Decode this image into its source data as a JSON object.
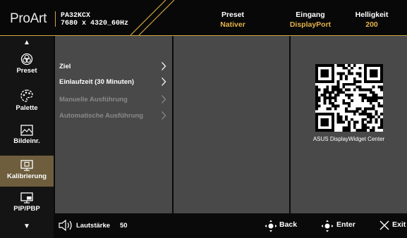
{
  "header": {
    "brand": "ProArt",
    "model": "PA32KCX",
    "resolution": "7680 x 4320_60Hz",
    "preset_label": "Preset",
    "preset_value": "Nativer",
    "input_label": "Eingang",
    "input_value": "DisplayPort",
    "brightness_label": "Helligkeit",
    "brightness_value": "200"
  },
  "sidebar": {
    "items": [
      {
        "label": "Preset",
        "icon": "preset-icon"
      },
      {
        "label": "Palette",
        "icon": "palette-icon"
      },
      {
        "label": "Bildeinr.",
        "icon": "image-icon"
      },
      {
        "label": "Kalibrierung",
        "icon": "calibration-icon",
        "active": true
      },
      {
        "label": "PIP/PBP",
        "icon": "pip-icon"
      }
    ]
  },
  "menu": {
    "items": [
      {
        "label": "Ziel",
        "enabled": true
      },
      {
        "label": "Einlaufzeit (30 Minuten)",
        "enabled": true
      },
      {
        "label": "Manuelle Ausführung",
        "enabled": false
      },
      {
        "label": "Automatische Ausführung",
        "enabled": false
      }
    ]
  },
  "qr": {
    "caption": "ASUS DisplayWidget Center"
  },
  "footer": {
    "volume_label": "Lautstärke",
    "volume_value": "50",
    "back_label": "Back",
    "enter_label": "Enter",
    "exit_label": "Exit"
  },
  "colors": {
    "accent": "#e5b24a",
    "active_bg": "#6e5e3e",
    "panel": "#494949"
  }
}
